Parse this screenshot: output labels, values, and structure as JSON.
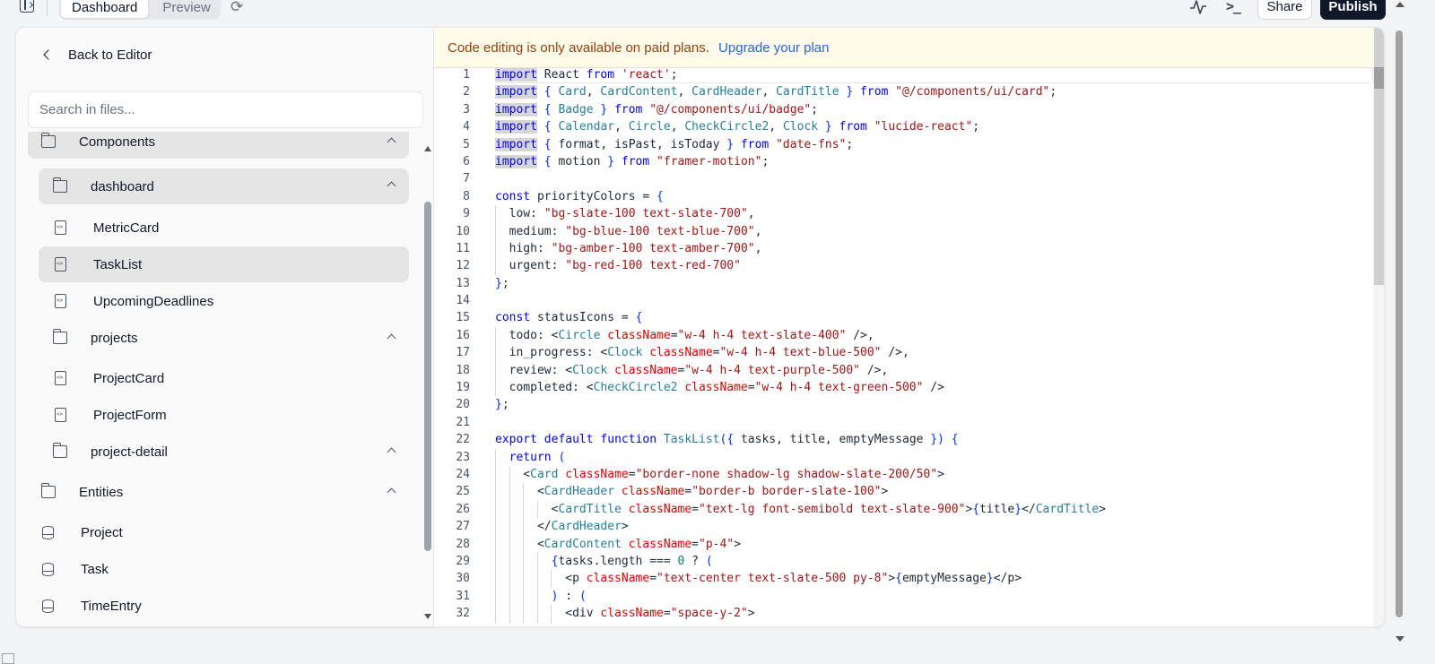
{
  "topbar": {
    "tabs": [
      "Dashboard",
      "Preview"
    ],
    "share": "Share",
    "publish": "Publish"
  },
  "sidebar": {
    "back": "Back to Editor",
    "search_placeholder": "Search in files...",
    "tree": [
      {
        "label": "Components",
        "icon": "folder-icon"
      },
      {
        "label": "dashboard",
        "icon": "folder-icon"
      },
      {
        "label": "MetricCard",
        "icon": "file-code-icon"
      },
      {
        "label": "TaskList",
        "icon": "file-code-icon"
      },
      {
        "label": "UpcomingDeadlines",
        "icon": "file-code-icon"
      },
      {
        "label": "projects",
        "icon": "folder-icon"
      },
      {
        "label": "ProjectCard",
        "icon": "file-code-icon"
      },
      {
        "label": "ProjectForm",
        "icon": "file-code-icon"
      },
      {
        "label": "project-detail",
        "icon": "folder-icon"
      },
      {
        "label": "Entities",
        "icon": "folder-icon"
      },
      {
        "label": "Project",
        "icon": "database-icon"
      },
      {
        "label": "Task",
        "icon": "database-icon"
      },
      {
        "label": "TimeEntry",
        "icon": "database-icon"
      }
    ]
  },
  "editor": {
    "banner_text": "Code editing is only available on paid plans.",
    "banner_link": "Upgrade your plan",
    "code": [
      "import React from 'react';",
      "import { Card, CardContent, CardHeader, CardTitle } from \"@/components/ui/card\";",
      "import { Badge } from \"@/components/ui/badge\";",
      "import { Calendar, Circle, CheckCircle2, Clock } from \"lucide-react\";",
      "import { format, isPast, isToday } from \"date-fns\";",
      "import { motion } from \"framer-motion\";",
      "",
      "const priorityColors = {",
      "  low: \"bg-slate-100 text-slate-700\",",
      "  medium: \"bg-blue-100 text-blue-700\",",
      "  high: \"bg-amber-100 text-amber-700\",",
      "  urgent: \"bg-red-100 text-red-700\"",
      "};",
      "",
      "const statusIcons = {",
      "  todo: <Circle className=\"w-4 h-4 text-slate-400\" />,",
      "  in_progress: <Clock className=\"w-4 h-4 text-blue-500\" />,",
      "  review: <Clock className=\"w-4 h-4 text-purple-500\" />,",
      "  completed: <CheckCircle2 className=\"w-4 h-4 text-green-500\" />",
      "};",
      "",
      "export default function TaskList({ tasks, title, emptyMessage }) {",
      "  return (",
      "    <Card className=\"border-none shadow-lg shadow-slate-200/50\">",
      "      <CardHeader className=\"border-b border-slate-100\">",
      "        <CardTitle className=\"text-lg font-semibold text-slate-900\">{title}</CardTitle>",
      "      </CardHeader>",
      "      <CardContent className=\"p-4\">",
      "        {tasks.length === 0 ? (",
      "          <p className=\"text-center text-slate-500 py-8\">{emptyMessage}</p>",
      "        ) : (",
      "          <div className=\"space-y-2\">"
    ]
  },
  "colors": {
    "keyword": "#0000ff",
    "string": "#a31515",
    "tag": "#267f99",
    "publish_bg": "#0f172a",
    "banner_bg": "#fffbea"
  }
}
